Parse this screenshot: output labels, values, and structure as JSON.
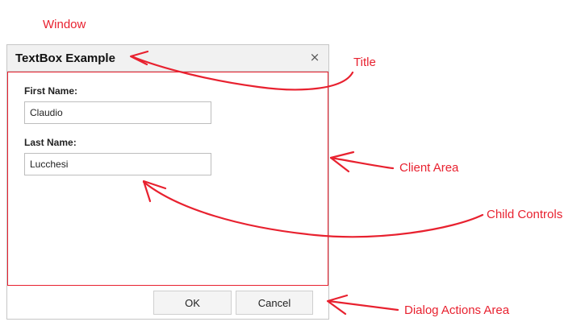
{
  "annotations": {
    "window": "Window",
    "title": "Title",
    "client_area": "Client Area",
    "child_controls": "Child Controls",
    "dialog_actions_area": "Dialog Actions Area"
  },
  "dialog": {
    "title": "TextBox Example",
    "close_glyph": "×",
    "fields": {
      "first_name_label": "First Name:",
      "first_name_value": "Claudio",
      "last_name_label": "Last Name:",
      "last_name_value": "Lucchesi"
    },
    "actions": {
      "ok_label": "OK",
      "cancel_label": "Cancel"
    }
  },
  "colors": {
    "annotation": "#e8212f",
    "titlebar": "#f1f1f1",
    "border": "#c6c6c6"
  }
}
